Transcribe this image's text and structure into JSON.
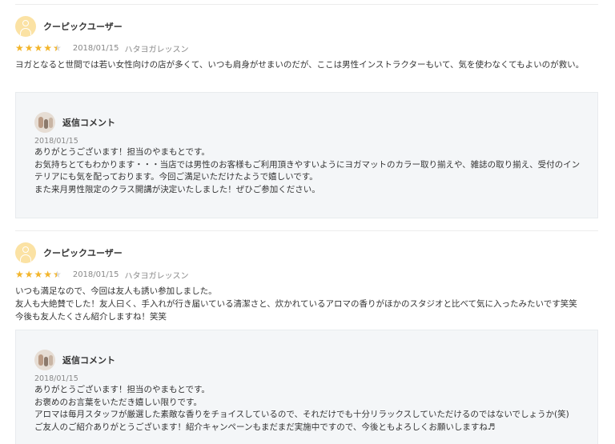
{
  "reviews": [
    {
      "user_name": "クーピックユーザー",
      "rating": 4,
      "date": "2018/01/15",
      "place": "ハタヨガレッスン",
      "text": "ヨガとなると世間では若い女性向けの店が多くて、いつも肩身がせまいのだが、ここは男性インストラクターもいて、気を使わなくてもよいのが救い。",
      "reply": {
        "title": "返信コメント",
        "date": "2018/01/15",
        "text": "ありがとうございます！担当のやまもとです。\nお気持ちとてもわかります・・・当店では男性のお客様もご利用頂きやすいようにヨガマットのカラー取り揃えや、雑誌の取り揃え、受付のインテリアにも気を配っております。今回ご満足いただけたようで嬉しいです。\nまた来月男性限定のクラス開講が決定いたしました！ぜひご参加ください。"
      }
    },
    {
      "user_name": "クーピックユーザー",
      "rating": 4,
      "date": "2018/01/15",
      "place": "ハタヨガレッスン",
      "text": "いつも満足なので、今回は友人も誘い参加しました。\n友人も大絶賛でした！友人曰く、手入れが行き届いている清潔さと、炊かれているアロマの香りがほかのスタジオと比べて気に入ったみたいです笑笑\n今後も友人たくさん紹介しますね！笑笑",
      "reply": {
        "title": "返信コメント",
        "date": "2018/01/15",
        "text": "ありがとうございます！担当のやまもとです。\nお褒めのお言葉をいただき嬉しい限りです。\nアロマは毎月スタッフが厳選した素敵な香りをチョイスしているので、それだけでも十分リラックスしていただけるのではないでしょうか(笑)\nご友人のご紹介ありがとうございます！紹介キャンペーンもまだまだ実施中ですので、今後ともよろしくお願いしますね♬"
      }
    }
  ],
  "colors": {
    "star": "#f3b52a",
    "avatar": "#fbe2a4",
    "reply_bg": "#f4f6f8"
  }
}
